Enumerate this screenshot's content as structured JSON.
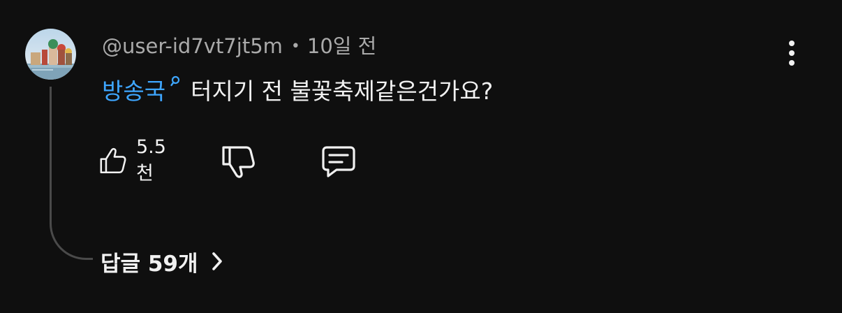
{
  "comment": {
    "author": "@user-id7vt7jt5m",
    "separator": "•",
    "timestamp": "10일 전",
    "search_link_text": "방송국",
    "body": "터지기 전 불꽃축제같은건가요?",
    "like_count": "5.5천",
    "replies_label": "답글 59개"
  },
  "icons": {
    "avatar": "avatar-image",
    "search": "search-icon",
    "more": "more-vert-icon",
    "like": "thumbs-up-icon",
    "dislike": "thumbs-down-icon",
    "reply": "reply-comment-icon",
    "chevron": "chevron-right-icon"
  },
  "colors": {
    "background": "#0f0f0f",
    "text_primary": "#f1f1f1",
    "text_secondary": "#aaaaaa",
    "link": "#3ea6ff",
    "thread_line": "#4a4a4a"
  }
}
